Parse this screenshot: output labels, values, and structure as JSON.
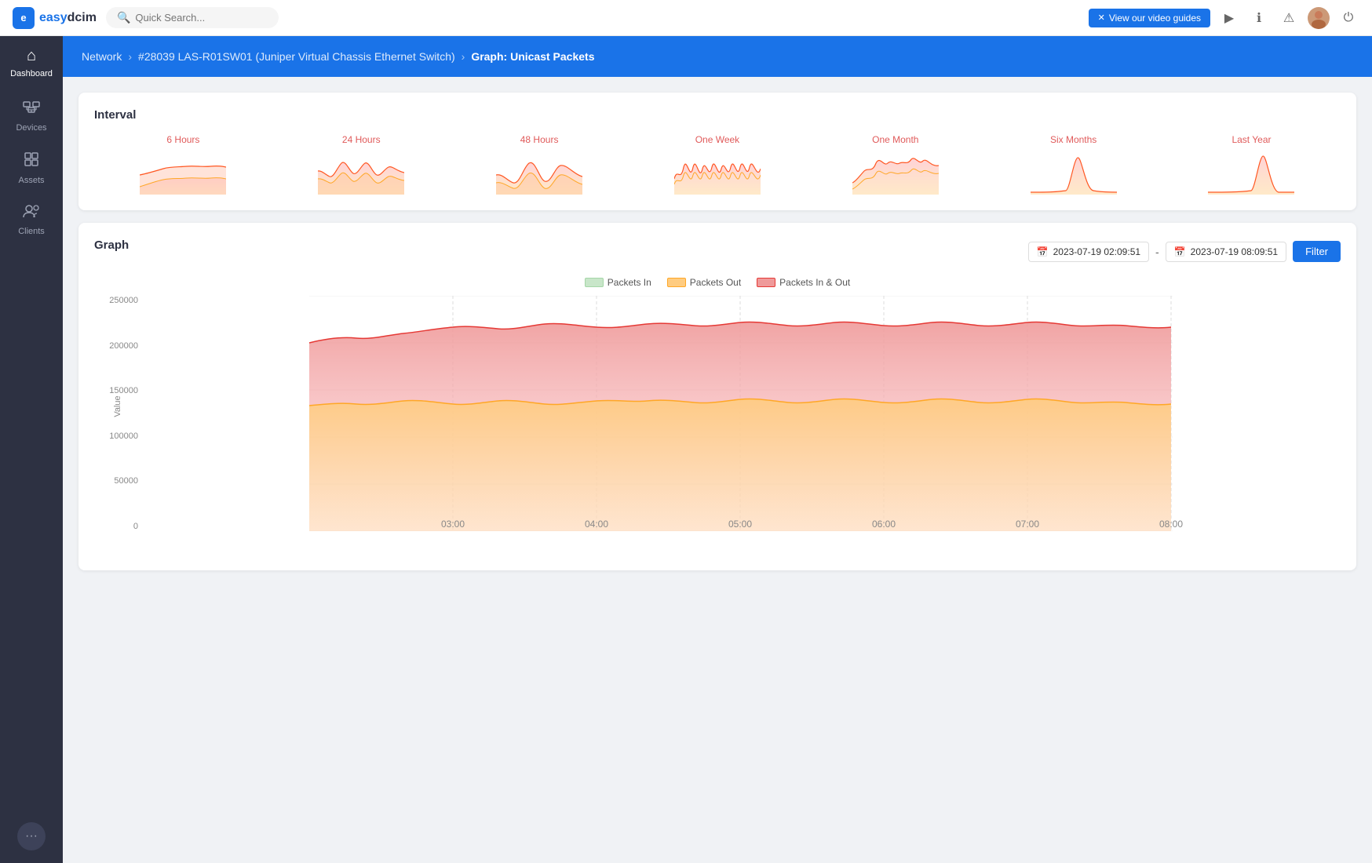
{
  "app": {
    "logo_text": "easy",
    "logo_highlight": "dcim"
  },
  "topbar": {
    "search_placeholder": "Quick Search...",
    "video_guide_label": "View our video guides"
  },
  "sidebar": {
    "items": [
      {
        "id": "dashboard",
        "label": "Dashboard",
        "icon": "⌂"
      },
      {
        "id": "devices",
        "label": "Devices",
        "icon": "⊞"
      },
      {
        "id": "assets",
        "label": "Assets",
        "icon": "◫"
      },
      {
        "id": "clients",
        "label": "Clients",
        "icon": "👥"
      }
    ],
    "more_icon": "···"
  },
  "breadcrumb": {
    "items": [
      {
        "label": "Network",
        "link": true
      },
      {
        "label": "#28039 LAS-R01SW01 (Juniper Virtual Chassis Ethernet Switch)",
        "link": true
      },
      {
        "label": "Graph: Unicast Packets",
        "link": false
      }
    ]
  },
  "interval": {
    "title": "Interval",
    "items": [
      {
        "label": "6 Hours",
        "id": "6h"
      },
      {
        "label": "24 Hours",
        "id": "24h"
      },
      {
        "label": "48 Hours",
        "id": "48h"
      },
      {
        "label": "One Week",
        "id": "1w"
      },
      {
        "label": "One Month",
        "id": "1m"
      },
      {
        "label": "Six Months",
        "id": "6m"
      },
      {
        "label": "Last Year",
        "id": "1y"
      }
    ]
  },
  "graph": {
    "title": "Graph",
    "date_from": "2023-07-19 02:09:51",
    "date_to": "2023-07-19 08:09:51",
    "filter_label": "Filter",
    "legend": [
      {
        "label": "Packets In",
        "color": "#c8e6c9",
        "border": "#a5d6a7"
      },
      {
        "label": "Packets Out",
        "color": "#ffcc80",
        "border": "#ffa726"
      },
      {
        "label": "Packets In & Out",
        "color": "#ef9a9a",
        "border": "#e53935"
      }
    ],
    "y_axis_labels": [
      "250000",
      "200000",
      "150000",
      "100000",
      "50000",
      "0"
    ],
    "x_axis_labels": [
      "03:00",
      "04:00",
      "05:00",
      "06:00",
      "07:00",
      "08:00"
    ],
    "y_label": "Value"
  }
}
